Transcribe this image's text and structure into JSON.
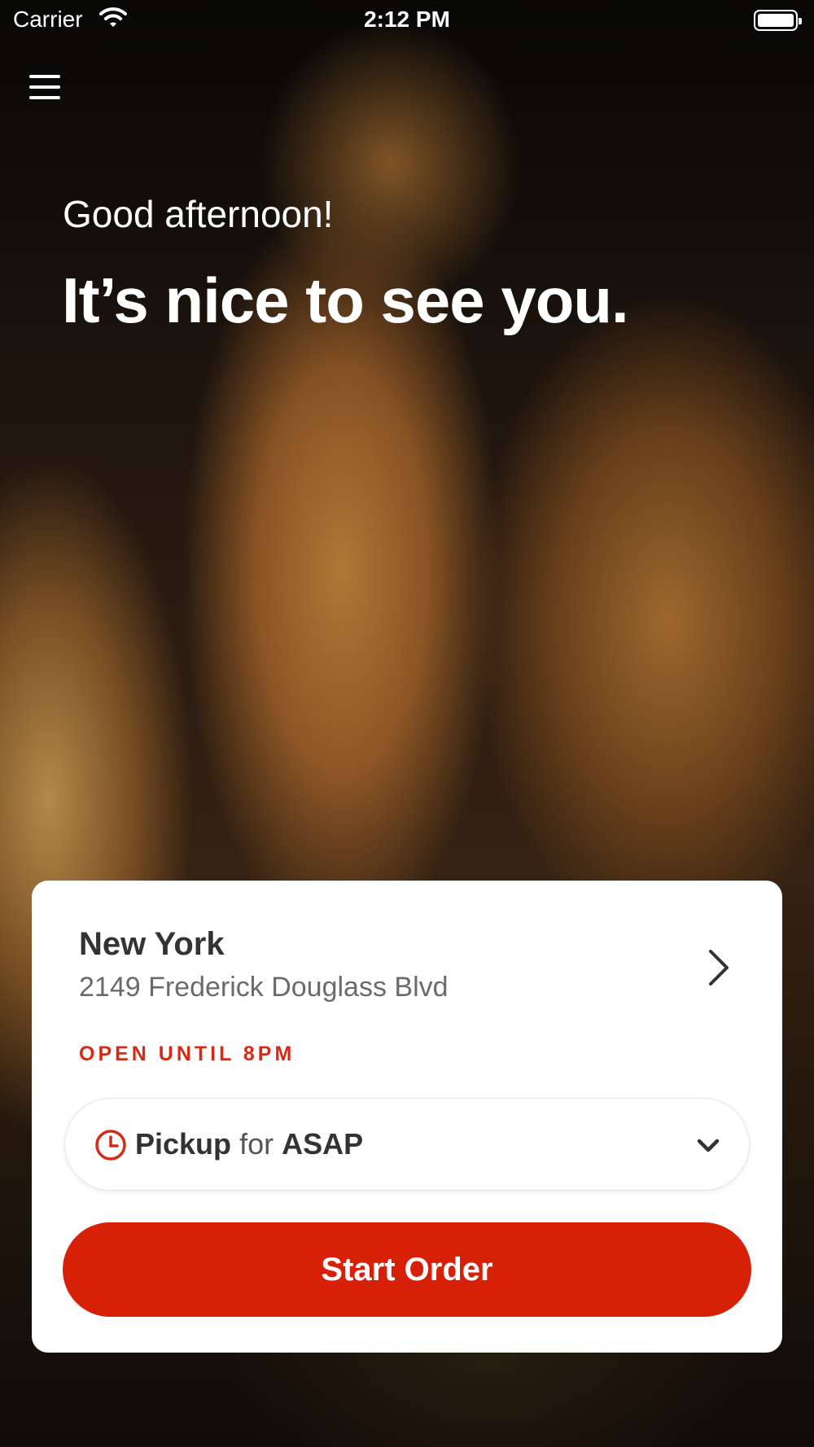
{
  "status_bar": {
    "carrier": "Carrier",
    "time": "2:12 PM"
  },
  "hero": {
    "greeting": "Good afternoon!",
    "headline": "It’s nice to see you."
  },
  "location": {
    "name": "New York",
    "address": "2149 Frederick Douglass Blvd",
    "hours": "OPEN UNTIL 8PM"
  },
  "order_mode": {
    "mode": "Pickup",
    "connector": "for",
    "time": "ASAP"
  },
  "start_button": {
    "label": "Start Order"
  },
  "colors": {
    "accent": "#d72008",
    "hours_text": "#d72a14",
    "card": "#ffffff"
  },
  "icons": [
    "wifi-icon",
    "battery-icon",
    "menu-icon",
    "chevron-right-icon",
    "clock-icon",
    "chevron-down-icon"
  ]
}
